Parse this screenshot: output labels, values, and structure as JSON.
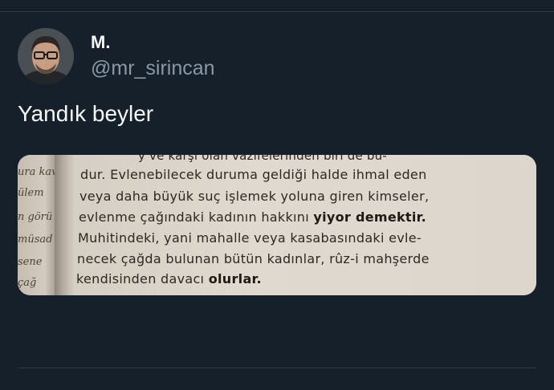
{
  "tweet": {
    "author": {
      "display_name": "M.",
      "handle": "@mr_sirincan"
    },
    "text": "Yandık beyler",
    "media": {
      "top_cut_line": "y   ve   karşı   olan   vazifelerinden   biri   de   bu-",
      "margin_words": [
        "ura kav",
        "ülem",
        "n görü",
        "müsad",
        "sene",
        "çağ"
      ],
      "book_lines": [
        {
          "pre": "dur. Evlenebilecek duruma geldiği halde ihmal eden",
          "bold": "",
          "post": ""
        },
        {
          "pre": "veya daha büyük suç işlemek yoluna giren kimseler,",
          "bold": "",
          "post": ""
        },
        {
          "pre": "evlenme çağındaki kadının hakkını ",
          "bold": "yiyor demektir.",
          "post": ""
        },
        {
          "pre": "Muhitindeki, yani mahalle veya kasabasındaki evle-",
          "bold": "",
          "post": ""
        },
        {
          "pre": "necek çağda bulunan bütün kadınlar, rûz-i mahşerde",
          "bold": "",
          "post": ""
        },
        {
          "pre": "kendisinden davacı ",
          "bold": "olurlar.",
          "post": ""
        }
      ]
    }
  },
  "colors": {
    "background": "#15202b",
    "primary_text": "#f7f9f9",
    "secondary_text": "#8b98a5",
    "paper": "#ddd6cc"
  }
}
